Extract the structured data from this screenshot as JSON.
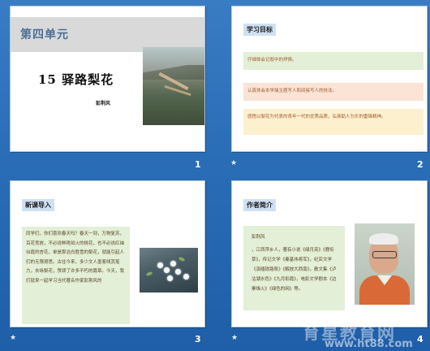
{
  "slides": [
    {
      "number": "1",
      "unit": "第四单元",
      "title": "15 驿路梨花",
      "author": "彭荆风"
    },
    {
      "number": "2",
      "transition_icon": "★",
      "heading": "学习目标",
      "goals": [
        "仔细体会记叙中的抒情。",
        "认真体会本学描主题写人和间接写人的技法。",
        "感悟以梨花为代表的青年一代的优秀品质，弘扬助人为乐的雷锋精神。"
      ]
    },
    {
      "number": "3",
      "transition_icon": "★",
      "heading": "新课导入",
      "body": "同学们，你们喜欢春天吗？春天一到，万物复苏，百花竞放，不必说鲜艳如火的桃花，也不必说红袖似霞的杏花，单是那洁白胜雪的梨花，就能引起人们的无限遐思。古往今来，多少文人墨客倾其笔力，去咏梨花，赞颂了许多不朽的篇章。今天，我们就来一起学习当代著名作家彭荆风的"
    },
    {
      "number": "4",
      "transition_icon": "★",
      "heading": "作者简介",
      "author_name": "彭荆风",
      "body": "，江西萍乡人，著有小说《绿月亮》《鹿衔草》，传记文学《秦基伟将军》，纪实文学《滇缅铁路祭》《解放大西南》，散文集《泸沽湖水色》《九月彩霞》，电影文学剧本《边寨烽火》《绿色的网》等。"
    }
  ],
  "watermark": {
    "text": "育星教育网",
    "url": "www.ht88.com"
  }
}
